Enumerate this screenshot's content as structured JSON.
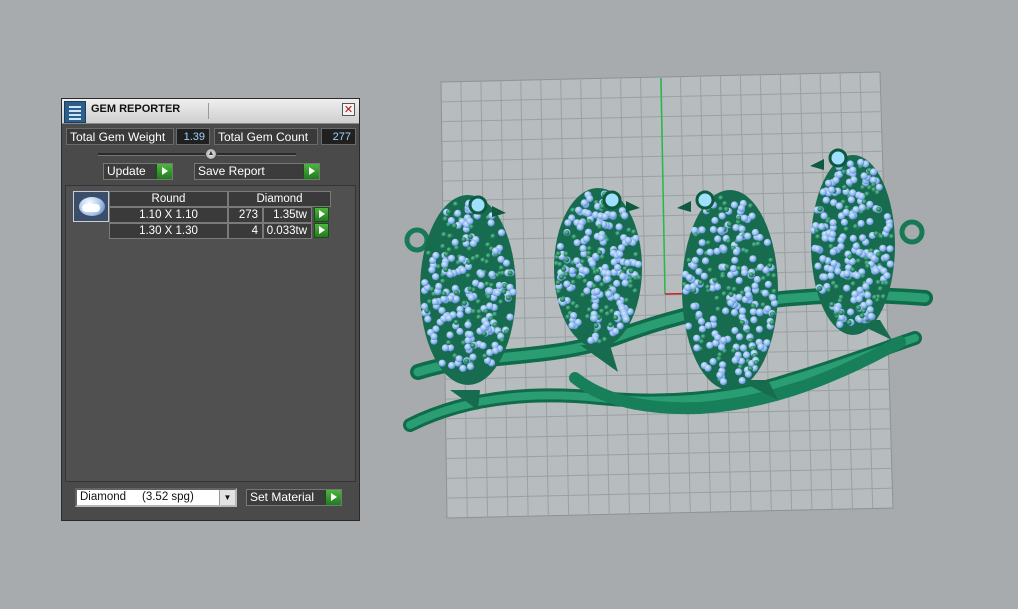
{
  "panel": {
    "title": "GEM REPORTER",
    "close_glyph": "✕",
    "stats": {
      "weight_label": "Total Gem Weight",
      "weight_value": "1.39",
      "count_label": "Total Gem Count",
      "count_value": "277"
    },
    "buttons": {
      "update": "Update",
      "save_report": "Save Report",
      "set_material": "Set Material"
    },
    "table": {
      "headers": [
        "Round",
        "Diamond"
      ],
      "rows": [
        {
          "size": "1.10 X 1.10",
          "count": "273",
          "weight": "1.35tw"
        },
        {
          "size": "1.30 X 1.30",
          "count": "4",
          "weight": "0.033tw"
        }
      ]
    },
    "material": {
      "selected": "Diamond     (3.52 spg)"
    }
  },
  "viewport": {
    "description_icons": [
      "gem-icon",
      "chevron-down-icon",
      "play-arrow-icon"
    ],
    "colors": {
      "background": "#a7abae",
      "metal": "#1f8a62",
      "gems": "#8fbaf0",
      "axis_y": "#22bb44",
      "axis_x": "#cc2222"
    }
  }
}
